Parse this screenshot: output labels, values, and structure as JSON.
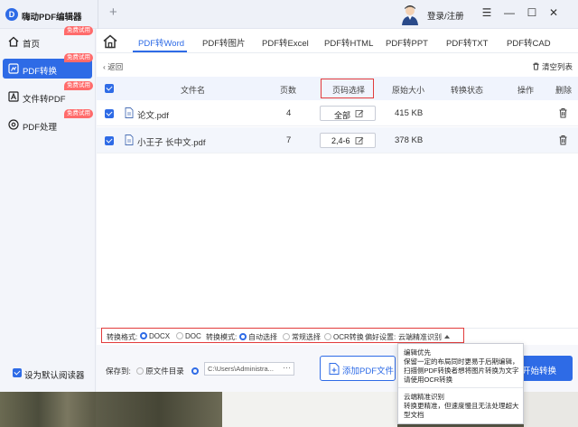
{
  "app": {
    "title": "嗨动PDF编辑器",
    "new_tab": "+"
  },
  "titlebar": {
    "login": "登录/注册",
    "menu": "☰",
    "minimize": "—",
    "maximize": "☐",
    "close": "✕"
  },
  "sidebar": {
    "items": [
      {
        "label": "首页",
        "badge": "免费试用",
        "icon": "home-icon"
      },
      {
        "label": "PDF转换",
        "badge": "免费试用",
        "icon": "pdf-convert-icon",
        "active": true
      },
      {
        "label": "文件转PDF",
        "badge": "免费试用",
        "icon": "file-to-pdf-icon"
      },
      {
        "label": "PDF处理",
        "badge": "免费试用",
        "icon": "pdf-process-icon"
      }
    ],
    "default_reader": "设为默认阅读器"
  },
  "tabs": [
    "PDF转Word",
    "PDF转图片",
    "PDF转Excel",
    "PDF转HTML",
    "PDF转PPT",
    "PDF转TXT",
    "PDF转CAD"
  ],
  "active_tab": "PDF转Word",
  "list": {
    "back": "返回",
    "clear": "清空列表",
    "columns": [
      "文件名",
      "页数",
      "页码选择",
      "原始大小",
      "转换状态",
      "操作",
      "删除"
    ],
    "rows": [
      {
        "name": "论文.pdf",
        "pages": "4",
        "page_select": "全部",
        "size": "415 KB"
      },
      {
        "name": "小王子 长中文.pdf",
        "pages": "7",
        "page_select": "2,4-6",
        "size": "378 KB"
      }
    ]
  },
  "options": {
    "format_label": "转换格式:",
    "docx": "DOCX",
    "doc": "DOC",
    "mode_label": "转换模式:",
    "auto": "自动选择",
    "normal": "常规选择",
    "ocr": "OCR转换",
    "pref_label": "偏好设置:",
    "pref_value": "云端精准识别"
  },
  "bottom": {
    "save_to": "保存到:",
    "source_dir": "原文件目录",
    "path": "C:\\Users\\Administra...",
    "path_more": "···",
    "add_pdf": "添加PDF文件",
    "start": "开始转换"
  },
  "popup": {
    "opt1_title": "编辑优先",
    "opt1_desc": "保留一定的布局同时更易于后期编辑，扫描侧PDF转换者想将图片转换为文字请使用OCR转换",
    "opt2_title": "云端精准识别",
    "opt2_desc": "转换更精准，但速度慢且无法处理超大型文档"
  },
  "colors": {
    "accent": "#2e6be6",
    "highlight": "#e23b3b",
    "badge": "#ff6b6b"
  }
}
